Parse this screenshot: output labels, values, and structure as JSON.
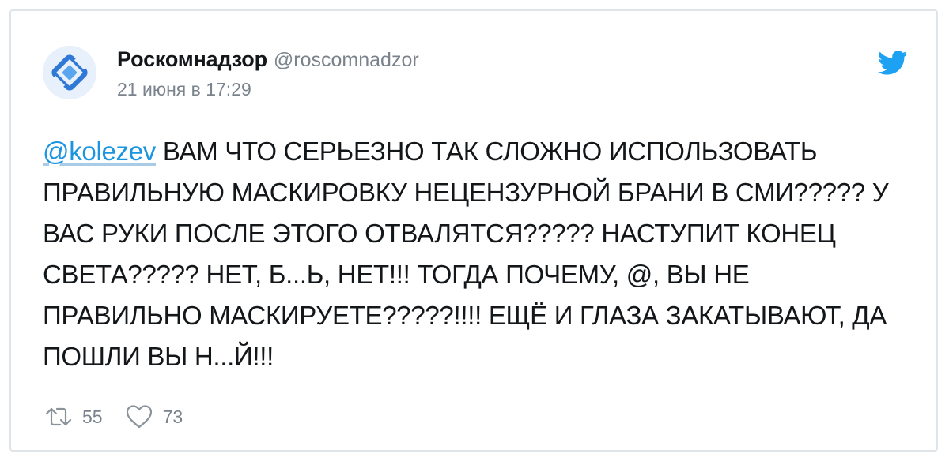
{
  "tweet": {
    "author": {
      "display_name": "Роскомнадзор",
      "handle": "@roscomnadzor",
      "avatar_icon": "roskomnadzor-logo-icon"
    },
    "timestamp": "21 июня в 17:29",
    "platform_icon": "twitter-bird-icon",
    "mention": "@kolezev",
    "text": " ВАМ ЧТО СЕРЬЕЗНО ТАК СЛОЖНО ИСПОЛЬЗОВАТЬ ПРАВИЛЬНУЮ МАСКИРОВКУ НЕЦЕНЗУРНОЙ БРАНИ В СМИ????? У ВАС РУКИ ПОСЛЕ ЭТОГО ОТВАЛЯТСЯ????? НАСТУПИТ КОНЕЦ СВЕТА????? НЕТ, Б...Ь, НЕТ!!! ТОГДА ПОЧЕМУ, @, ВЫ НЕ ПРАВИЛЬНО МАСКИРУЕТЕ?????!!!! ЕЩЁ И ГЛАЗА ЗАКАТЫВАЮТ, ДА ПОШЛИ ВЫ Н...Й!!!",
    "actions": {
      "retweet_count": "55",
      "like_count": "73"
    }
  },
  "colors": {
    "link": "#1b95e0",
    "twitter_blue": "#1da1f2",
    "muted_text": "#7a838c",
    "body_text": "#14171a",
    "card_border": "#dfe4e8"
  }
}
